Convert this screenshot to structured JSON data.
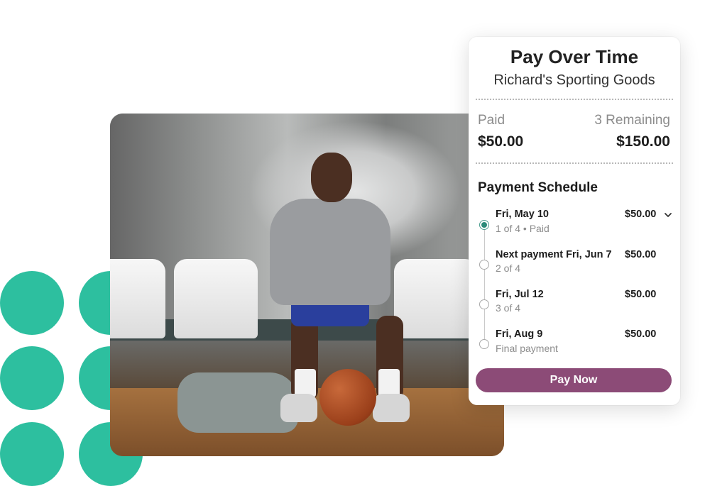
{
  "card": {
    "title": "Pay Over Time",
    "merchant": "Richard's Sporting Goods",
    "paid_label": "Paid",
    "paid_amount": "$50.00",
    "remaining_label": "3 Remaining",
    "remaining_amount": "$150.00",
    "schedule_title": "Payment Schedule",
    "payments": [
      {
        "date": "Fri, May 10",
        "detail": "1 of 4 • Paid",
        "amount": "$50.00",
        "status": "paid"
      },
      {
        "date": "Next payment Fri, Jun 7",
        "detail": "2 of 4",
        "amount": "$50.00",
        "status": "upcoming"
      },
      {
        "date": "Fri, Jul 12",
        "detail": "3 of 4",
        "amount": "$50.00",
        "status": "upcoming"
      },
      {
        "date": "Fri, Aug 9",
        "detail": "Final payment",
        "amount": "$50.00",
        "status": "upcoming"
      }
    ],
    "expand_icon": "chevron-down-icon",
    "pay_button_label": "Pay Now"
  },
  "colors": {
    "accent_teal": "#2dbf9f",
    "pay_button": "#8c4b77",
    "paid_dot": "#2b8b7a"
  }
}
